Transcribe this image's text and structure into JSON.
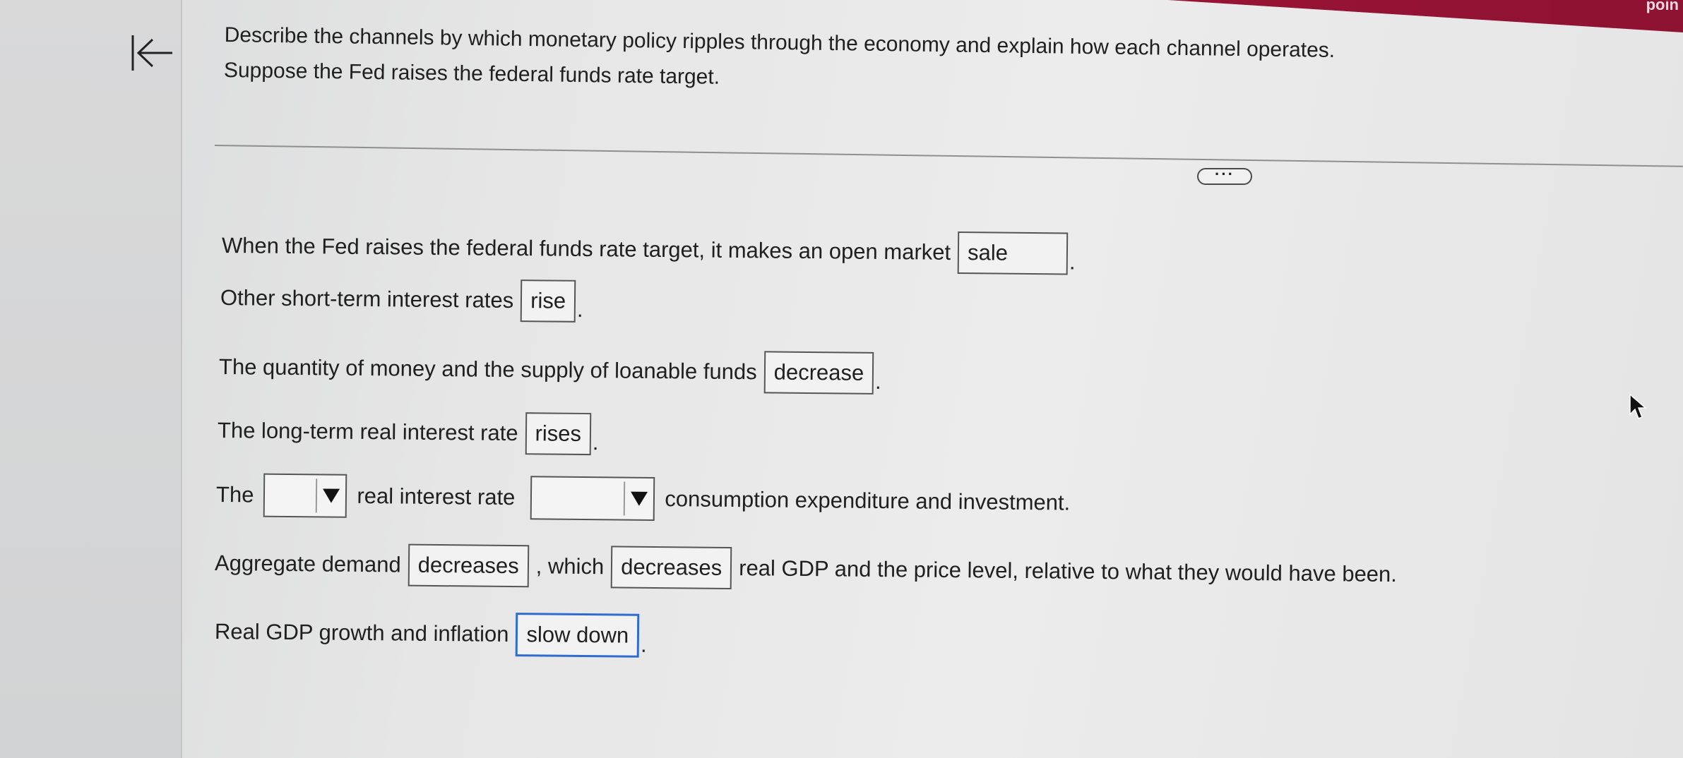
{
  "top_bar": {
    "text": "poin"
  },
  "question": {
    "line1": "Describe the channels by which monetary policy ripples through the economy and explain how each channel operates.",
    "line2": "Suppose the Fed raises the federal funds rate target."
  },
  "more_button": {
    "label": "···"
  },
  "rows": [
    {
      "pre": "When the Fed raises the federal funds rate target, it makes an open market",
      "answer": "sale",
      "post": "."
    },
    {
      "pre": "Other short-term interest rates",
      "answer": "rise",
      "post": "."
    },
    {
      "pre": "The quantity of money and the supply of loanable funds",
      "answer": "decrease",
      "post": "."
    },
    {
      "pre": "The long-term real interest rate",
      "answer": "rises",
      "post": "."
    },
    {
      "pre": "The",
      "mid": "real interest rate",
      "post": "consumption expenditure and investment."
    },
    {
      "pre": "Aggregate demand",
      "answer": "decreases",
      "mid": ", which",
      "answer2": "decreases",
      "post": "real GDP and the price level, relative to what they would have been."
    },
    {
      "pre": "Real GDP growth and inflation",
      "answer": "slow down",
      "post": "."
    }
  ]
}
